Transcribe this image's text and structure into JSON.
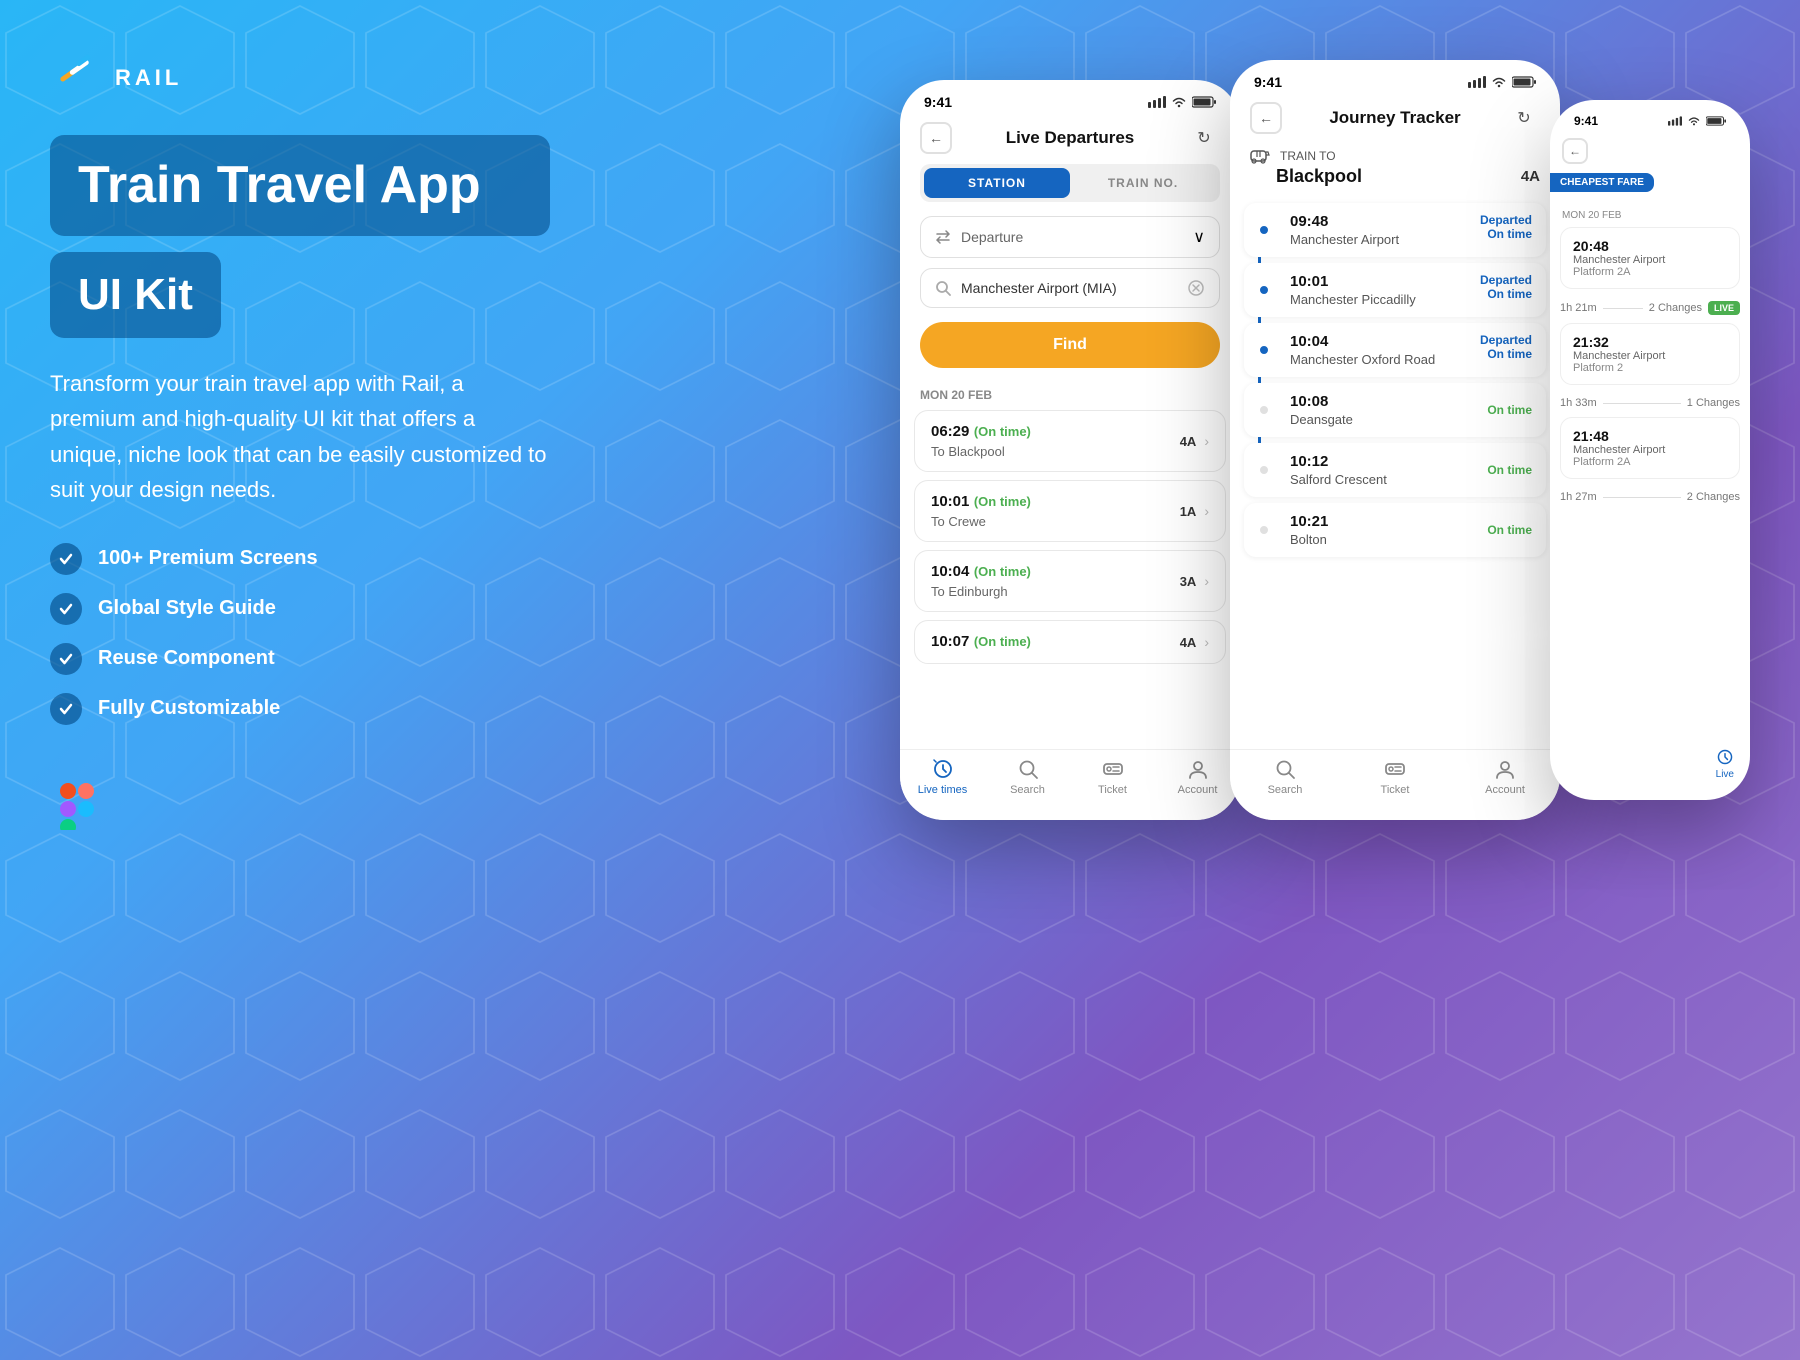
{
  "brand": {
    "name": "RAIL",
    "tagline": "Train Travel App"
  },
  "left_panel": {
    "title": "Train Travel App",
    "subtitle": "UI Kit",
    "description": "Transform your train travel app with Rail, a premium and high-quality UI kit that offers a unique, niche look that can be easily customized to suit your design needs.",
    "features": [
      "100+ Premium Screens",
      "Global Style Guide",
      "Reuse Component",
      "Fully Customizable"
    ]
  },
  "phone_main": {
    "time": "9:41",
    "screen_title": "Live Departures",
    "tabs": [
      "STATION",
      "TRAIN NO."
    ],
    "active_tab": 0,
    "departure_label": "Departure",
    "search_placeholder": "Manchester Airport (MIA)",
    "find_button": "Find",
    "date_label": "MON 20 FEB",
    "trains": [
      {
        "time": "06:29",
        "status": "On time",
        "dest": "Blackpool",
        "platform": "4A"
      },
      {
        "time": "10:01",
        "status": "On time",
        "dest": "Crewe",
        "platform": "1A"
      },
      {
        "time": "10:04",
        "status": "On time",
        "dest": "Edinburgh",
        "platform": "3A"
      },
      {
        "time": "10:07",
        "status": "On time",
        "dest": "",
        "platform": "4A"
      }
    ],
    "nav": [
      {
        "label": "Live times",
        "icon": "⏱",
        "active": true
      },
      {
        "label": "Search",
        "icon": "🔍",
        "active": false
      },
      {
        "label": "Ticket",
        "icon": "🎫",
        "active": false
      },
      {
        "label": "Account",
        "icon": "👤",
        "active": false
      }
    ]
  },
  "phone_middle": {
    "time": "9:41",
    "screen_title": "Journey Tracker",
    "train_to": "TRAIN TO",
    "destination": "Blackpool",
    "platform": "4A",
    "stops": [
      {
        "time": "09:48",
        "name": "Manchester Airport",
        "status": "Departed",
        "status2": "On time"
      },
      {
        "time": "10:01",
        "name": "Manchester Piccadilly",
        "status": "Departed",
        "status2": "On time"
      },
      {
        "time": "10:04",
        "name": "Manchester Oxford Road",
        "status": "Departed",
        "status2": "On time"
      },
      {
        "time": "10:08",
        "name": "Deansgate",
        "status": "On time",
        "status2": ""
      },
      {
        "time": "10:12",
        "name": "Salford Crescent",
        "status": "On time",
        "status2": ""
      },
      {
        "time": "10:21",
        "name": "Bolton",
        "status": "On time",
        "status2": ""
      }
    ],
    "nav": [
      {
        "label": "Search",
        "icon": "🔍",
        "active": false
      },
      {
        "label": "Ticket",
        "icon": "🎫",
        "active": false
      },
      {
        "label": "Account",
        "icon": "👤",
        "active": false
      }
    ]
  },
  "phone_right": {
    "time": "9:41",
    "fare_badge": "CHEAPEST FARE",
    "date_label": "MON 20 FEB",
    "results": [
      {
        "time": "20:48",
        "station": "Manchester Airport",
        "platform": "Platform 2A",
        "duration": "1h 21m",
        "changes": "2 Changes",
        "live": true
      },
      {
        "time": "21:32",
        "station": "Manchester Airport",
        "platform": "Platform 2",
        "duration": "1h 33m",
        "changes": "1 Changes",
        "live": false
      },
      {
        "time": "21:48",
        "station": "Manchester Airport",
        "platform": "Platform 2A",
        "duration": "1h 27m",
        "changes": "2 Changes",
        "live": false
      }
    ],
    "nav_label": "Live"
  },
  "colors": {
    "primary_blue": "#1565c0",
    "accent_yellow": "#f5a623",
    "on_time_green": "#4caf50",
    "bg_gradient_start": "#29b6f6",
    "bg_gradient_end": "#9575cd"
  }
}
